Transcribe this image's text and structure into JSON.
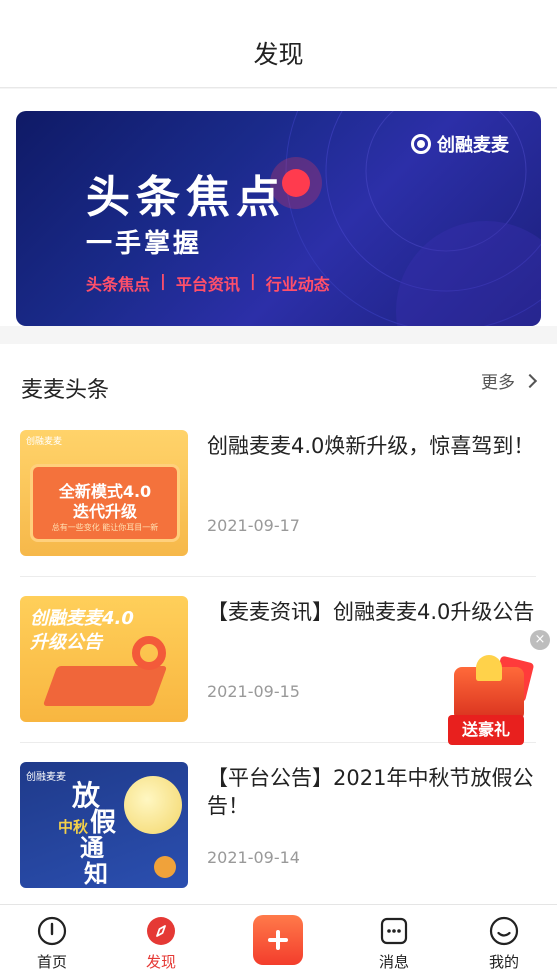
{
  "header": {
    "title": "发现"
  },
  "banner": {
    "brand": "创融麦麦",
    "title": "头条焦点",
    "subtitle": "一手掌握",
    "tags": [
      "头条焦点",
      "平台资讯",
      "行业动态"
    ],
    "tag_separator": "|"
  },
  "section": {
    "title": "麦麦头条",
    "more_label": "更多"
  },
  "news": [
    {
      "title": "创融麦麦4.0焕新升级，惊喜驾到！",
      "date": "2021-09-17",
      "thumb": {
        "brand": "创融麦麦",
        "line1": "全新模式4.0",
        "line2": "迭代升级",
        "line3": "总有一些变化 能让你耳目一新"
      }
    },
    {
      "title": "【麦麦资讯】创融麦麦4.0升级公告",
      "date": "2021-09-15",
      "thumb": {
        "line1": "创融麦麦4.0",
        "line2": "升级公告"
      }
    },
    {
      "title": "【平台公告】2021年中秋节放假公告！",
      "date": "2021-09-14",
      "thumb": {
        "brand": "创融麦麦",
        "chars": [
          "放",
          "假",
          "通",
          "知"
        ],
        "festival": "中秋"
      }
    }
  ],
  "gift": {
    "label": "送豪礼",
    "close": "×"
  },
  "tabbar": [
    {
      "label": "首页",
      "icon": "info-circle-icon",
      "active": false
    },
    {
      "label": "发现",
      "icon": "compass-icon",
      "active": true
    },
    {
      "label": "",
      "icon": "plus-icon",
      "active": false
    },
    {
      "label": "消息",
      "icon": "message-icon",
      "active": false
    },
    {
      "label": "我的",
      "icon": "smile-icon",
      "active": false
    }
  ],
  "colors": {
    "accent": "#e53935",
    "banner_tag": "#ff4f6a"
  }
}
